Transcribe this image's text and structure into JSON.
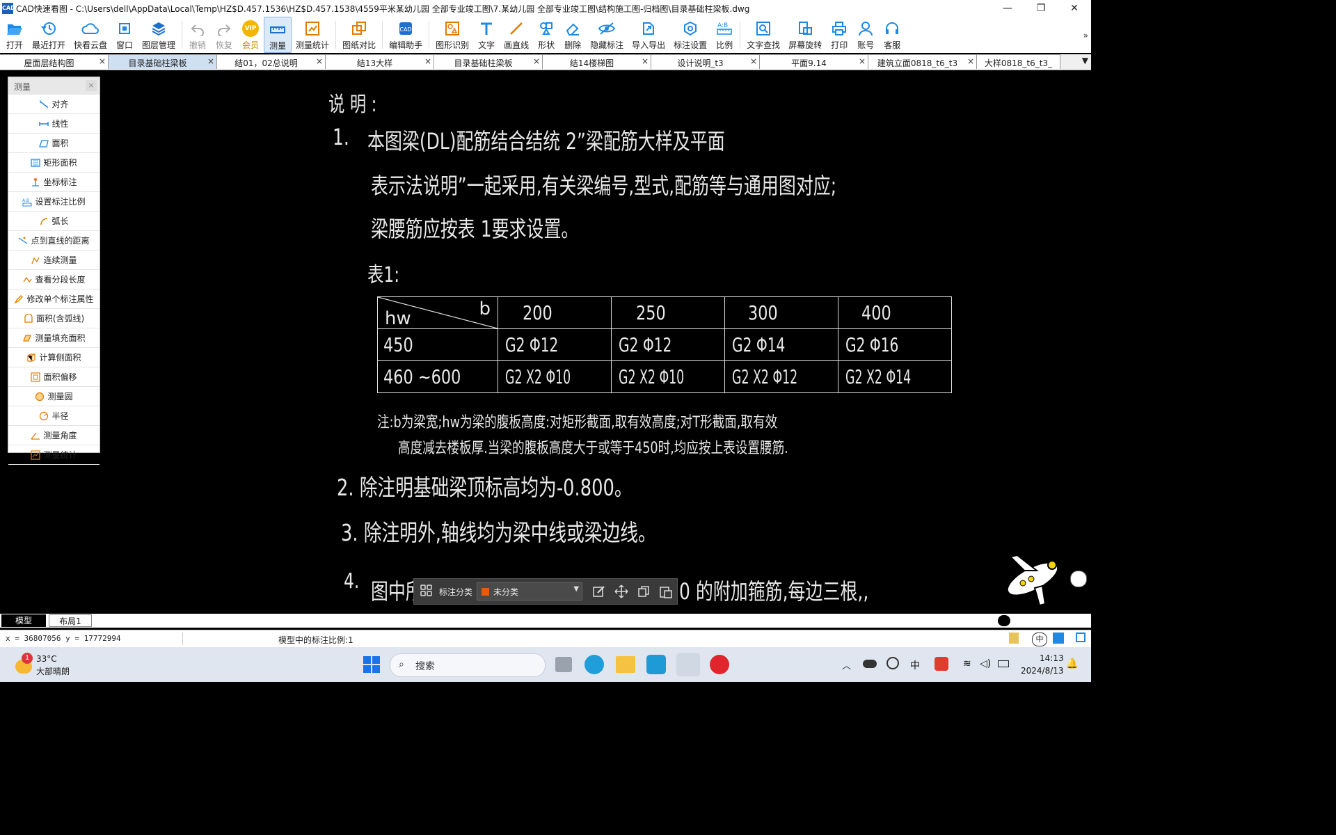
{
  "titlebar": {
    "app_icon_text": "CAD",
    "title": "CAD快速看图 - C:\\Users\\dell\\AppData\\Local\\Temp\\HZ$D.457.1536\\HZ$D.457.1538\\4559平米某幼儿园 全部专业竣工图\\7.某幼儿园 全部专业竣工图\\结构施工图-归档图\\目录基础柱梁板.dwg",
    "minimize": "—",
    "restore": "❐",
    "close": "✕"
  },
  "toolbar": {
    "items": [
      {
        "label": "打开",
        "icon": "folder-open-icon"
      },
      {
        "label": "最近打开",
        "icon": "history-icon"
      },
      {
        "label": "快看云盘",
        "icon": "cloud-icon"
      },
      {
        "label": "窗口",
        "icon": "window-icon"
      },
      {
        "label": "图层管理",
        "icon": "layers-icon"
      },
      {
        "label": "撤销",
        "icon": "undo-icon"
      },
      {
        "label": "恢复",
        "icon": "redo-icon"
      },
      {
        "label": "会员",
        "icon": "vip-icon"
      },
      {
        "label": "测量",
        "icon": "measure-icon"
      },
      {
        "label": "测量统计",
        "icon": "measure-stats-icon"
      },
      {
        "label": "图纸对比",
        "icon": "compare-icon"
      },
      {
        "label": "编辑助手",
        "icon": "edit-assistant-icon"
      },
      {
        "label": "图形识别",
        "icon": "shape-recognize-icon"
      },
      {
        "label": "文字",
        "icon": "text-icon"
      },
      {
        "label": "画直线",
        "icon": "line-icon"
      },
      {
        "label": "形状",
        "icon": "shape-icon"
      },
      {
        "label": "删除",
        "icon": "eraser-icon"
      },
      {
        "label": "隐藏标注",
        "icon": "hide-annotation-icon"
      },
      {
        "label": "导入导出",
        "icon": "import-export-icon"
      },
      {
        "label": "标注设置",
        "icon": "annotation-settings-icon"
      },
      {
        "label": "比例",
        "icon": "scale-icon"
      },
      {
        "label": "文字查找",
        "icon": "text-search-icon"
      },
      {
        "label": "屏幕旋转",
        "icon": "rotate-screen-icon"
      },
      {
        "label": "打印",
        "icon": "printer-icon"
      },
      {
        "label": "账号",
        "icon": "account-icon"
      },
      {
        "label": "客服",
        "icon": "headset-icon"
      }
    ],
    "vip_text": "VIP",
    "more": "»"
  },
  "tabs": {
    "items": [
      "屋面层结构图",
      "目录基础柱梁板",
      "结01，02总说明",
      "结13大样",
      "目录基础柱梁板",
      "结14楼梯图",
      "设计说明_t3",
      "平面9.14",
      "建筑立面0818_t6_t3",
      "大样0818_t6_t3_"
    ],
    "close": "×",
    "dropdown": "▼"
  },
  "measure_panel": {
    "title": "测量",
    "close": "×",
    "items": [
      "对齐",
      "线性",
      "面积",
      "矩形面积",
      "坐标标注",
      "设置标注比例",
      "弧长",
      "点到直线的距离",
      "连续测量",
      "查看分段长度",
      "修改单个标注属性",
      "面积(含弧线)",
      "测量填充面积",
      "计算侧面积",
      "面积偏移",
      "测量圆",
      "半径",
      "测量角度",
      "测量统计"
    ]
  },
  "drawing": {
    "heading": "说  明 :",
    "item1_num": "1.",
    "item1_line1": "本图梁(DL)配筋结合结统 2”梁配筋大样及平面",
    "item1_line2": "表示法说明”一起采用,有关梁编号,型式,配筋等与通用图对应;",
    "item1_line3": "梁腰筋应按表 1要求设置。",
    "table_label": "表1:",
    "table": {
      "corner_b": "b",
      "corner_hw": "hw",
      "headers": [
        "200",
        "250",
        "300",
        "400"
      ],
      "rows": [
        {
          "hw": "450",
          "cells": [
            "G2 Φ12",
            "G2 Φ12",
            "G2 Φ14",
            "G2 Φ16"
          ]
        },
        {
          "hw": "460 ~600",
          "cells": [
            "G2 X2 Φ10",
            "G2 X2 Φ10",
            "G2 X2 Φ12",
            "G2 X2 Φ14"
          ]
        }
      ]
    },
    "note_line1": "注:b为梁宽;hw为梁的腹板高度:对矩形截面,取有效高度;对T形截面,取有效",
    "note_line2": "高度减去楼板厚.当梁的腹板高度大于或等于450时,均应按上表设置腰筋.",
    "item2": "2. 除注明基础梁顶标高均为-0.800。",
    "item3": "3. 除注明外,轴线均为梁中线或梁边线。",
    "item4_num": "4.",
    "item4_start": "图中所有",
    "item4_end": "0 的附加箍筋,每边三根,,"
  },
  "annotation_bar": {
    "label": "标注分类",
    "select_value": "未分类",
    "color": "#e85a0c"
  },
  "layout_tabs": [
    "模型",
    "布局1"
  ],
  "status": {
    "coords": "x = 36807056  y = 17772994",
    "scale": "模型中的标注比例:1"
  },
  "taskbar": {
    "weather_badge": "1",
    "temperature": "33°C",
    "weather": "大部晴朗",
    "search_placeholder": "搜索",
    "ime": "中",
    "time": "14:13",
    "date": "2024/8/13"
  },
  "colors": {
    "canvas": "#000000",
    "cad_text": "#e8e8e8",
    "accent": "#1e6fd0",
    "active_tab": "#cfe0f3"
  }
}
